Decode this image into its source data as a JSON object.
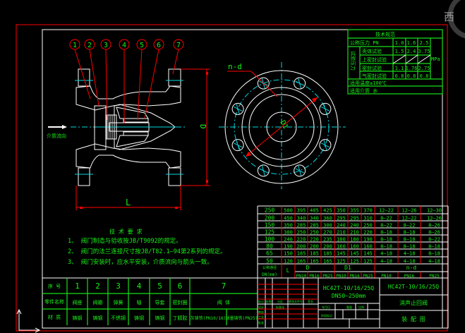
{
  "viewcube": {
    "label": "西"
  },
  "balloons": [
    "1",
    "2",
    "3",
    "4",
    "5",
    "6",
    "7"
  ],
  "dims": {
    "D": "D",
    "L": "L",
    "D1": "D1",
    "nd": "n-d",
    "flow": "介质流向"
  },
  "spec_table": {
    "title": "技术规范",
    "pn_label": "公称压力 PN",
    "pn": [
      "1.0",
      "1.6",
      "2.5"
    ],
    "side_label": "试验压力",
    "rows": [
      {
        "label": "壳体试验",
        "values": [
          "1.5",
          "2.4",
          "3.75"
        ]
      },
      {
        "label": "上密封试验",
        "values": [
          "",
          "",
          ""
        ]
      },
      {
        "label": "密封试验",
        "values": [
          "1.1",
          "1.76",
          "2.75"
        ]
      },
      {
        "label": "气密封试验",
        "values": [
          "0.8",
          "0.8",
          "0.8"
        ]
      }
    ],
    "unit": "MPa",
    "temperature": "适用温度≤100℃",
    "medium": "适用介质 水"
  },
  "notes": {
    "title": "技 术 要 求",
    "items": [
      "1、 阀门制造与验收按JB/T9092的规定。",
      "2、 阀门的法兰连接尺寸按JB/T82.1—94第2系列的规定。",
      "3、 阀门安装时，应水平安装，介质流向与箭头一致。"
    ]
  },
  "dim_table": {
    "rows": [
      [
        "250",
        "500",
        "395",
        "405",
        "425",
        "350",
        "355",
        "370",
        "12—22",
        "12—26",
        "12—30"
      ],
      [
        "200",
        "450",
        "340",
        "340",
        "360",
        "295",
        "295",
        "310",
        "8—22",
        "12—22",
        "12—26"
      ],
      [
        "150",
        "350",
        "285",
        "285",
        "300",
        "240",
        "240",
        "250",
        "8—22",
        "8—22",
        "8—26"
      ],
      [
        "125",
        "300",
        "250",
        "250",
        "270",
        "210",
        "210",
        "220",
        "8—18",
        "8—18",
        "8—26"
      ],
      [
        "100",
        "240",
        "220",
        "220",
        "235",
        "180",
        "180",
        "190",
        "8—18",
        "8—18",
        "8—22"
      ],
      [
        "80",
        "190",
        "200",
        "200",
        "200",
        "160",
        "160",
        "160",
        "8—18",
        "8—18",
        "8—18"
      ],
      [
        "65",
        "150",
        "185",
        "185",
        "185",
        "145",
        "145",
        "145",
        "4—18",
        "4—18",
        "8—18"
      ],
      [
        "50",
        "120",
        "165",
        "165",
        "165",
        "125",
        "125",
        "125",
        "4—18",
        "4—18",
        "4—18"
      ]
    ],
    "header_dn": "DN(mm)",
    "header_dn_top": "公称通径",
    "header_L": "L",
    "header_D": "D",
    "header_D1": "D1",
    "header_nd": "n-d",
    "sub_headers": [
      "PN10",
      "PN16",
      "PN25",
      "PN10",
      "PN16",
      "PN25",
      "PN10",
      "PN16",
      "PN25"
    ]
  },
  "parts_table": {
    "row_labels": [
      "序 号",
      "零件名称",
      "材 质"
    ],
    "numbers": [
      "1",
      "2",
      "3",
      "4",
      "5",
      "6",
      "7"
    ],
    "names": [
      "阀座",
      "阀瓣",
      "弹簧",
      "轴",
      "导套",
      "密封圈",
      "阀 体"
    ],
    "materials": [
      "铸钢",
      "铸钢",
      "不锈钢",
      "铸钢",
      "铸钢",
      "丁腈胶",
      "灰铸铁(PN10/16)",
      "球墨铸铁(PN25)"
    ]
  },
  "title_block": {
    "model": "HC42T-10/16/25Q",
    "range": "DN50~250mm",
    "model_right": "HC42T-10/16/25Q",
    "product_name": "消声止回阀",
    "drawing_type": "装 配 图",
    "small_labels": [
      "标记",
      "处数",
      "分区",
      "更改文件号",
      "签名",
      "年月日",
      "设计",
      "标准化",
      "审核",
      "工艺",
      "批准",
      "阶段标记",
      "重量",
      "比例"
    ]
  }
}
